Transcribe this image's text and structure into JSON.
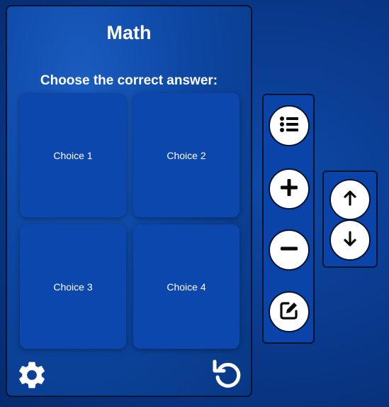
{
  "quiz": {
    "title": "Math",
    "prompt": "Choose the correct answer:",
    "choices": [
      "Choice 1",
      "Choice 2",
      "Choice 3",
      "Choice 4"
    ]
  },
  "icons": {
    "settings": "gear-icon",
    "reset": "reset-icon",
    "list": "list-icon",
    "add": "plus-icon",
    "remove": "minus-icon",
    "edit": "edit-icon",
    "up": "arrow-up-icon",
    "down": "arrow-down-icon"
  },
  "colors": {
    "background": "#0a3b8f",
    "card": "#0d47a3",
    "choice": "#0b47ad",
    "border": "#041430",
    "button": "#ffffff"
  }
}
